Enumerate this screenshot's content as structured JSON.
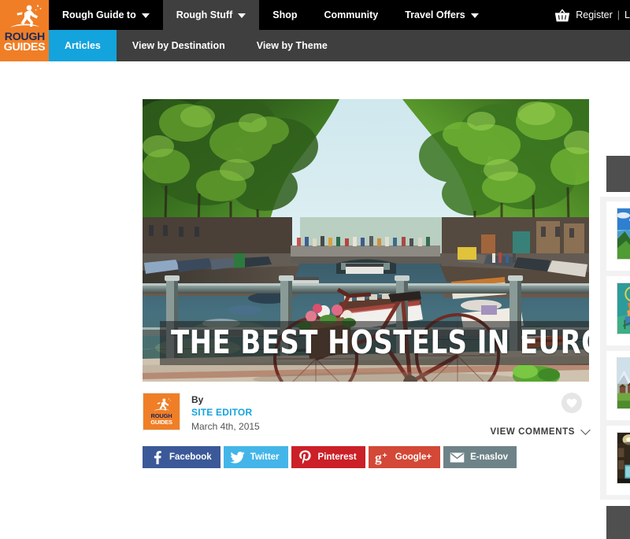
{
  "site": {
    "logo_word1": "ROUGH",
    "logo_word2": "GUIDES",
    "brand_orange": "#F07E26",
    "accent_blue": "#13A3DD"
  },
  "topnav": {
    "items": [
      {
        "label": "Rough Guide to",
        "has_caret": true,
        "active": false
      },
      {
        "label": "Rough Stuff",
        "has_caret": true,
        "active": true
      },
      {
        "label": "Shop",
        "has_caret": false,
        "active": false
      },
      {
        "label": "Community",
        "has_caret": false,
        "active": false
      },
      {
        "label": "Travel Offers",
        "has_caret": true,
        "active": false
      }
    ],
    "register_label": "Register",
    "separator": "|",
    "login_label": "L",
    "basket_icon": "basket-icon"
  },
  "subnav": {
    "items": [
      {
        "label": "Articles",
        "active": true
      },
      {
        "label": "View by Destination",
        "active": false
      },
      {
        "label": "View by Theme",
        "active": false
      }
    ]
  },
  "article": {
    "title": "THE BEST HOSTELS IN EUROPE",
    "hero_alt": "Amsterdam canal with boats, trees and a bicycle on a bridge railing",
    "by_label": "By",
    "author": "SITE EDITOR",
    "date": "March 4th, 2015",
    "view_comments_label": "VIEW COMMENTS",
    "favourite_icon": "heart-icon",
    "author_badge_word1": "ROUGH",
    "author_badge_word2": "GUIDES"
  },
  "share": {
    "buttons": [
      {
        "label": "Facebook",
        "icon": "facebook-icon",
        "color": "#3B5998"
      },
      {
        "label": "Twitter",
        "icon": "twitter-icon",
        "color": "#44B5E8"
      },
      {
        "label": "Pinterest",
        "icon": "pinterest-icon",
        "color": "#CB2027"
      },
      {
        "label": "Google+",
        "icon": "googleplus-icon",
        "color": "#D34836"
      },
      {
        "label": "E-naslov",
        "icon": "envelope-icon",
        "color": "#6E8387"
      }
    ]
  },
  "sidebar": {
    "cards": [
      {
        "thumb_name": "thumb-coastal-bay"
      },
      {
        "thumb_name": "thumb-cyclist-illustration"
      },
      {
        "thumb_name": "thumb-mountain-village"
      },
      {
        "thumb_name": "thumb-night-street"
      }
    ]
  }
}
